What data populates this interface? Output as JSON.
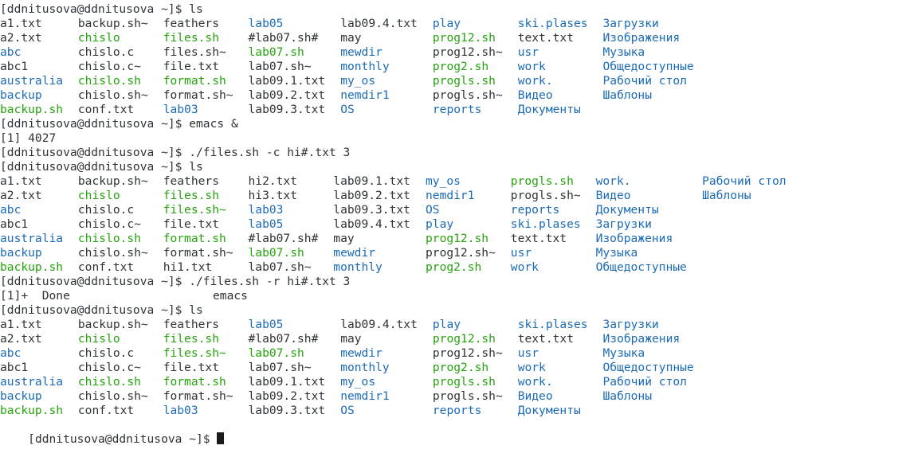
{
  "colors": {
    "background": "#ffffff",
    "default": "#2e3436",
    "green": "#26a30f",
    "blue": "#1c6bb5",
    "cursor": "#1a1a1a"
  },
  "terminal": {
    "lines": [
      {
        "cells": [
          {
            "t": "[ddnitusova@ddnitusova ~]$ ls",
            "c": "default",
            "col": 0
          }
        ]
      },
      {
        "cells": [
          {
            "t": "a1.txt",
            "c": "default",
            "col": 0
          },
          {
            "t": "backup.sh~",
            "c": "default",
            "col": 11
          },
          {
            "t": "feathers",
            "c": "default",
            "col": 23
          },
          {
            "t": "lab05",
            "c": "blue",
            "col": 35
          },
          {
            "t": "lab09.4.txt",
            "c": "default",
            "col": 48
          },
          {
            "t": "play",
            "c": "blue",
            "col": 61
          },
          {
            "t": "ski.plases",
            "c": "blue",
            "col": 73
          },
          {
            "t": "Загрузки",
            "c": "blue",
            "col": 85
          }
        ]
      },
      {
        "cells": [
          {
            "t": "a2.txt",
            "c": "default",
            "col": 0
          },
          {
            "t": "chislo",
            "c": "green",
            "col": 11
          },
          {
            "t": "files.sh",
            "c": "green",
            "col": 23
          },
          {
            "t": "#lab07.sh#",
            "c": "default",
            "col": 35
          },
          {
            "t": "may",
            "c": "default",
            "col": 48
          },
          {
            "t": "prog12.sh",
            "c": "green",
            "col": 61
          },
          {
            "t": "text.txt",
            "c": "default",
            "col": 73
          },
          {
            "t": "Изображения",
            "c": "blue",
            "col": 85
          }
        ]
      },
      {
        "cells": [
          {
            "t": "abc",
            "c": "blue",
            "col": 0
          },
          {
            "t": "chislo.c",
            "c": "default",
            "col": 11
          },
          {
            "t": "files.sh~",
            "c": "default",
            "col": 23
          },
          {
            "t": "lab07.sh",
            "c": "green",
            "col": 35
          },
          {
            "t": "mewdir",
            "c": "blue",
            "col": 48
          },
          {
            "t": "prog12.sh~",
            "c": "default",
            "col": 61
          },
          {
            "t": "usr",
            "c": "blue",
            "col": 73
          },
          {
            "t": "Музыка",
            "c": "blue",
            "col": 85
          }
        ]
      },
      {
        "cells": [
          {
            "t": "abc1",
            "c": "default",
            "col": 0
          },
          {
            "t": "chislo.c~",
            "c": "default",
            "col": 11
          },
          {
            "t": "file.txt",
            "c": "default",
            "col": 23
          },
          {
            "t": "lab07.sh~",
            "c": "default",
            "col": 35
          },
          {
            "t": "monthly",
            "c": "blue",
            "col": 48
          },
          {
            "t": "prog2.sh",
            "c": "green",
            "col": 61
          },
          {
            "t": "work",
            "c": "blue",
            "col": 73
          },
          {
            "t": "Общедоступные",
            "c": "blue",
            "col": 85
          }
        ]
      },
      {
        "cells": [
          {
            "t": "australia",
            "c": "blue",
            "col": 0
          },
          {
            "t": "chislo.sh",
            "c": "green",
            "col": 11
          },
          {
            "t": "format.sh",
            "c": "green",
            "col": 23
          },
          {
            "t": "lab09.1.txt",
            "c": "default",
            "col": 35
          },
          {
            "t": "my_os",
            "c": "blue",
            "col": 48
          },
          {
            "t": "progls.sh",
            "c": "green",
            "col": 61
          },
          {
            "t": "work.",
            "c": "blue",
            "col": 73
          },
          {
            "t": "Рабочий стол",
            "c": "blue",
            "col": 85
          }
        ]
      },
      {
        "cells": [
          {
            "t": "backup",
            "c": "blue",
            "col": 0
          },
          {
            "t": "chislo.sh~",
            "c": "default",
            "col": 11
          },
          {
            "t": "format.sh~",
            "c": "default",
            "col": 23
          },
          {
            "t": "lab09.2.txt",
            "c": "default",
            "col": 35
          },
          {
            "t": "nemdir1",
            "c": "blue",
            "col": 48
          },
          {
            "t": "progls.sh~",
            "c": "default",
            "col": 61
          },
          {
            "t": "Видео",
            "c": "blue",
            "col": 73
          },
          {
            "t": "Шаблоны",
            "c": "blue",
            "col": 85
          }
        ]
      },
      {
        "cells": [
          {
            "t": "backup.sh",
            "c": "green",
            "col": 0
          },
          {
            "t": "conf.txt",
            "c": "default",
            "col": 11
          },
          {
            "t": "lab03",
            "c": "blue",
            "col": 23
          },
          {
            "t": "lab09.3.txt",
            "c": "default",
            "col": 35
          },
          {
            "t": "OS",
            "c": "blue",
            "col": 48
          },
          {
            "t": "reports",
            "c": "blue",
            "col": 61
          },
          {
            "t": "Документы",
            "c": "blue",
            "col": 73
          }
        ]
      },
      {
        "cells": [
          {
            "t": "[ddnitusova@ddnitusova ~]$ emacs &",
            "c": "default",
            "col": 0
          }
        ]
      },
      {
        "cells": [
          {
            "t": "[1] 4027",
            "c": "default",
            "col": 0
          }
        ]
      },
      {
        "cells": [
          {
            "t": "[ddnitusova@ddnitusova ~]$ ./files.sh -c hi#.txt 3",
            "c": "default",
            "col": 0
          }
        ]
      },
      {
        "cells": [
          {
            "t": "[ddnitusova@ddnitusova ~]$ ls",
            "c": "default",
            "col": 0
          }
        ]
      },
      {
        "cells": [
          {
            "t": "a1.txt",
            "c": "default",
            "col": 0
          },
          {
            "t": "backup.sh~",
            "c": "default",
            "col": 11
          },
          {
            "t": "feathers",
            "c": "default",
            "col": 23
          },
          {
            "t": "hi2.txt",
            "c": "default",
            "col": 35
          },
          {
            "t": "lab09.1.txt",
            "c": "default",
            "col": 47
          },
          {
            "t": "my_os",
            "c": "blue",
            "col": 60
          },
          {
            "t": "progls.sh",
            "c": "green",
            "col": 72
          },
          {
            "t": "work.",
            "c": "blue",
            "col": 84
          },
          {
            "t": "Рабочий стол",
            "c": "blue",
            "col": 99
          }
        ]
      },
      {
        "cells": [
          {
            "t": "a2.txt",
            "c": "default",
            "col": 0
          },
          {
            "t": "chislo",
            "c": "green",
            "col": 11
          },
          {
            "t": "files.sh",
            "c": "green",
            "col": 23
          },
          {
            "t": "hi3.txt",
            "c": "default",
            "col": 35
          },
          {
            "t": "lab09.2.txt",
            "c": "default",
            "col": 47
          },
          {
            "t": "nemdir1",
            "c": "blue",
            "col": 60
          },
          {
            "t": "progls.sh~",
            "c": "default",
            "col": 72
          },
          {
            "t": "Видео",
            "c": "blue",
            "col": 84
          },
          {
            "t": "Шаблоны",
            "c": "blue",
            "col": 99
          }
        ]
      },
      {
        "cells": [
          {
            "t": "abc",
            "c": "blue",
            "col": 0
          },
          {
            "t": "chislo.c",
            "c": "default",
            "col": 11
          },
          {
            "t": "files.sh~",
            "c": "green",
            "col": 23
          },
          {
            "t": "lab03",
            "c": "blue",
            "col": 35
          },
          {
            "t": "lab09.3.txt",
            "c": "default",
            "col": 47
          },
          {
            "t": "OS",
            "c": "blue",
            "col": 60
          },
          {
            "t": "reports",
            "c": "blue",
            "col": 72
          },
          {
            "t": "Документы",
            "c": "blue",
            "col": 84
          }
        ]
      },
      {
        "cells": [
          {
            "t": "abc1",
            "c": "default",
            "col": 0
          },
          {
            "t": "chislo.c~",
            "c": "default",
            "col": 11
          },
          {
            "t": "file.txt",
            "c": "default",
            "col": 23
          },
          {
            "t": "lab05",
            "c": "blue",
            "col": 35
          },
          {
            "t": "lab09.4.txt",
            "c": "default",
            "col": 47
          },
          {
            "t": "play",
            "c": "blue",
            "col": 60
          },
          {
            "t": "ski.plases",
            "c": "blue",
            "col": 72
          },
          {
            "t": "Загрузки",
            "c": "blue",
            "col": 84
          }
        ]
      },
      {
        "cells": [
          {
            "t": "australia",
            "c": "blue",
            "col": 0
          },
          {
            "t": "chislo.sh",
            "c": "green",
            "col": 11
          },
          {
            "t": "format.sh",
            "c": "green",
            "col": 23
          },
          {
            "t": "#lab07.sh#",
            "c": "default",
            "col": 35
          },
          {
            "t": "may",
            "c": "default",
            "col": 47
          },
          {
            "t": "prog12.sh",
            "c": "green",
            "col": 60
          },
          {
            "t": "text.txt",
            "c": "default",
            "col": 72
          },
          {
            "t": "Изображения",
            "c": "blue",
            "col": 84
          }
        ]
      },
      {
        "cells": [
          {
            "t": "backup",
            "c": "blue",
            "col": 0
          },
          {
            "t": "chislo.sh~",
            "c": "default",
            "col": 11
          },
          {
            "t": "format.sh~",
            "c": "default",
            "col": 23
          },
          {
            "t": "lab07.sh",
            "c": "green",
            "col": 35
          },
          {
            "t": "mewdir",
            "c": "blue",
            "col": 47
          },
          {
            "t": "prog12.sh~",
            "c": "default",
            "col": 60
          },
          {
            "t": "usr",
            "c": "blue",
            "col": 72
          },
          {
            "t": "Музыка",
            "c": "blue",
            "col": 84
          }
        ]
      },
      {
        "cells": [
          {
            "t": "backup.sh",
            "c": "green",
            "col": 0
          },
          {
            "t": "conf.txt",
            "c": "default",
            "col": 11
          },
          {
            "t": "hi1.txt",
            "c": "default",
            "col": 23
          },
          {
            "t": "lab07.sh~",
            "c": "default",
            "col": 35
          },
          {
            "t": "monthly",
            "c": "blue",
            "col": 47
          },
          {
            "t": "prog2.sh",
            "c": "green",
            "col": 60
          },
          {
            "t": "work",
            "c": "blue",
            "col": 72
          },
          {
            "t": "Общедоступные",
            "c": "blue",
            "col": 84
          }
        ]
      },
      {
        "cells": [
          {
            "t": "[ddnitusova@ddnitusova ~]$ ./files.sh -r hi#.txt 3",
            "c": "default",
            "col": 0
          }
        ]
      },
      {
        "cells": [
          {
            "t": "[1]+  Done",
            "c": "default",
            "col": 0
          },
          {
            "t": "emacs",
            "c": "default",
            "col": 30
          }
        ]
      },
      {
        "cells": [
          {
            "t": "[ddnitusova@ddnitusova ~]$ ls",
            "c": "default",
            "col": 0
          }
        ]
      },
      {
        "cells": [
          {
            "t": "a1.txt",
            "c": "default",
            "col": 0
          },
          {
            "t": "backup.sh~",
            "c": "default",
            "col": 11
          },
          {
            "t": "feathers",
            "c": "default",
            "col": 23
          },
          {
            "t": "lab05",
            "c": "blue",
            "col": 35
          },
          {
            "t": "lab09.4.txt",
            "c": "default",
            "col": 48
          },
          {
            "t": "play",
            "c": "blue",
            "col": 61
          },
          {
            "t": "ski.plases",
            "c": "blue",
            "col": 73
          },
          {
            "t": "Загрузки",
            "c": "blue",
            "col": 85
          }
        ]
      },
      {
        "cells": [
          {
            "t": "a2.txt",
            "c": "default",
            "col": 0
          },
          {
            "t": "chislo",
            "c": "green",
            "col": 11
          },
          {
            "t": "files.sh",
            "c": "green",
            "col": 23
          },
          {
            "t": "#lab07.sh#",
            "c": "default",
            "col": 35
          },
          {
            "t": "may",
            "c": "default",
            "col": 48
          },
          {
            "t": "prog12.sh",
            "c": "green",
            "col": 61
          },
          {
            "t": "text.txt",
            "c": "default",
            "col": 73
          },
          {
            "t": "Изображения",
            "c": "blue",
            "col": 85
          }
        ]
      },
      {
        "cells": [
          {
            "t": "abc",
            "c": "blue",
            "col": 0
          },
          {
            "t": "chislo.c",
            "c": "default",
            "col": 11
          },
          {
            "t": "files.sh~",
            "c": "green",
            "col": 23
          },
          {
            "t": "lab07.sh",
            "c": "green",
            "col": 35
          },
          {
            "t": "mewdir",
            "c": "blue",
            "col": 48
          },
          {
            "t": "prog12.sh~",
            "c": "default",
            "col": 61
          },
          {
            "t": "usr",
            "c": "blue",
            "col": 73
          },
          {
            "t": "Музыка",
            "c": "blue",
            "col": 85
          }
        ]
      },
      {
        "cells": [
          {
            "t": "abc1",
            "c": "default",
            "col": 0
          },
          {
            "t": "chislo.c~",
            "c": "default",
            "col": 11
          },
          {
            "t": "file.txt",
            "c": "default",
            "col": 23
          },
          {
            "t": "lab07.sh~",
            "c": "default",
            "col": 35
          },
          {
            "t": "monthly",
            "c": "blue",
            "col": 48
          },
          {
            "t": "prog2.sh",
            "c": "green",
            "col": 61
          },
          {
            "t": "work",
            "c": "blue",
            "col": 73
          },
          {
            "t": "Общедоступные",
            "c": "blue",
            "col": 85
          }
        ]
      },
      {
        "cells": [
          {
            "t": "australia",
            "c": "blue",
            "col": 0
          },
          {
            "t": "chislo.sh",
            "c": "green",
            "col": 11
          },
          {
            "t": "format.sh",
            "c": "green",
            "col": 23
          },
          {
            "t": "lab09.1.txt",
            "c": "default",
            "col": 35
          },
          {
            "t": "my_os",
            "c": "blue",
            "col": 48
          },
          {
            "t": "progls.sh",
            "c": "green",
            "col": 61
          },
          {
            "t": "work.",
            "c": "blue",
            "col": 73
          },
          {
            "t": "Рабочий стол",
            "c": "blue",
            "col": 85
          }
        ]
      },
      {
        "cells": [
          {
            "t": "backup",
            "c": "blue",
            "col": 0
          },
          {
            "t": "chislo.sh~",
            "c": "default",
            "col": 11
          },
          {
            "t": "format.sh~",
            "c": "default",
            "col": 23
          },
          {
            "t": "lab09.2.txt",
            "c": "default",
            "col": 35
          },
          {
            "t": "nemdir1",
            "c": "blue",
            "col": 48
          },
          {
            "t": "progls.sh~",
            "c": "default",
            "col": 61
          },
          {
            "t": "Видео",
            "c": "blue",
            "col": 73
          },
          {
            "t": "Шаблоны",
            "c": "blue",
            "col": 85
          }
        ]
      },
      {
        "cells": [
          {
            "t": "backup.sh",
            "c": "green",
            "col": 0
          },
          {
            "t": "conf.txt",
            "c": "default",
            "col": 11
          },
          {
            "t": "lab03",
            "c": "blue",
            "col": 23
          },
          {
            "t": "lab09.3.txt",
            "c": "default",
            "col": 35
          },
          {
            "t": "OS",
            "c": "blue",
            "col": 48
          },
          {
            "t": "reports",
            "c": "blue",
            "col": 61
          },
          {
            "t": "Документы",
            "c": "blue",
            "col": 73
          }
        ]
      }
    ],
    "prompt": "[ddnitusova@ddnitusova ~]$ "
  }
}
